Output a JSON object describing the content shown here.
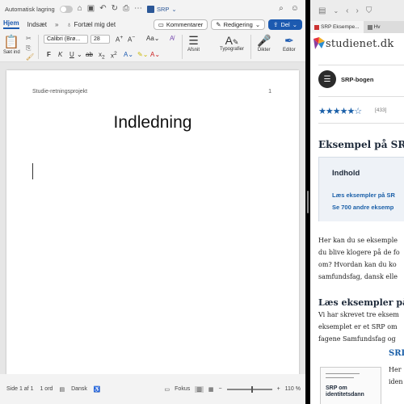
{
  "word": {
    "titlebar": {
      "autosave_label": "Automatisk lagring",
      "doc_name": "SRP"
    },
    "tabs": [
      {
        "label": "Hjem",
        "active": true
      },
      {
        "label": "Indsæt",
        "active": false
      }
    ],
    "tell_me": "Fortæl mig det",
    "comments_label": "Kommentarer",
    "editing_label": "Redigering",
    "share_label": "Del",
    "ribbon": {
      "paste_label": "Sæt ind",
      "font_name": "Calibri (Brø...",
      "font_size": "28",
      "paragraph_label": "Afsnit",
      "styles_label": "Typografier",
      "dictate_label": "Dikter",
      "editor_label": "Editor"
    },
    "document": {
      "header_text": "Studie-retningsprojekt",
      "page_number": "1",
      "heading": "Indledning"
    },
    "status": {
      "page": "Side 1 af 1",
      "words": "1 ord",
      "language": "Dansk",
      "focus": "Fokus",
      "zoom": "110 %"
    }
  },
  "browser": {
    "tabs": [
      {
        "label": "SRP Eksempe...",
        "active": true
      },
      {
        "label": "Hv",
        "active": false
      }
    ],
    "logo_text": "studienet.dk",
    "category": "SRP-bogen",
    "rating_count": "[433]",
    "title": "Eksempel på SR",
    "index": {
      "heading": "Indhold",
      "links": [
        "Læs eksempler på SR",
        "Se 700 andre eksemp"
      ]
    },
    "intro_lines": [
      "Her kan du se eksemple",
      "du blive klogere på de fo",
      "om? Hvordan kan du ko",
      "samfundsfag, dansk elle"
    ],
    "section_heading": "Læs eksempler på",
    "section_lines": [
      "Vi har skrevet tre eksem",
      "eksemplet er et SRP om",
      "fagene Samfundsfag og"
    ],
    "book": {
      "cover_title_1": "SRP om",
      "cover_title_2": "identitetsdann",
      "title": "SRI",
      "text_1": "Her",
      "text_2": "iden"
    }
  }
}
